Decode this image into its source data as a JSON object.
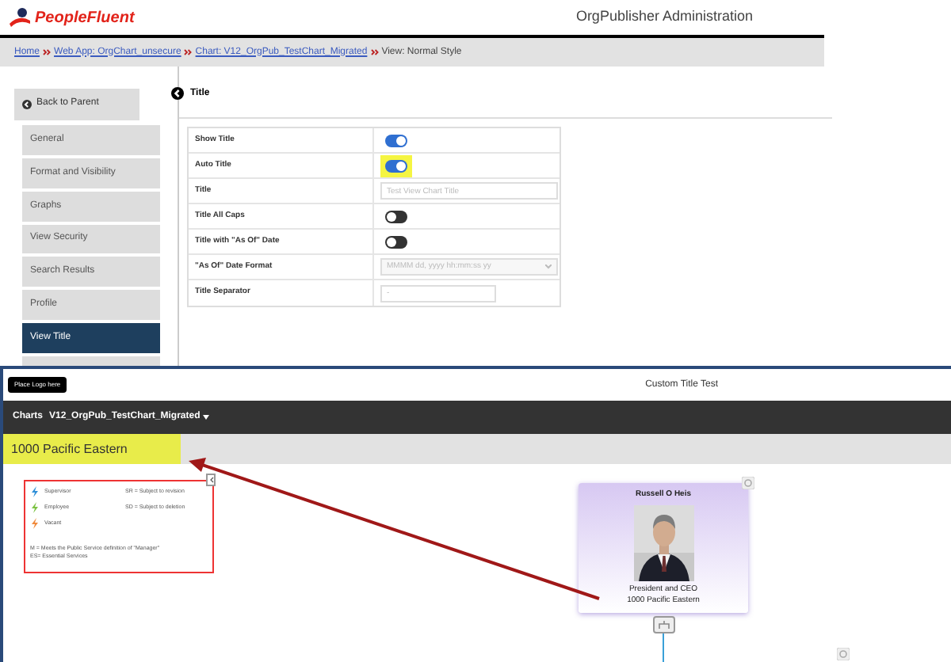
{
  "header": {
    "logo": "PeopleFluent",
    "title": "OrgPublisher Administration"
  },
  "breadcrumb": [
    {
      "kind": "link",
      "text": "Home"
    },
    {
      "kind": "link",
      "text": "Web App: OrgChart_unsecure"
    },
    {
      "kind": "link",
      "text": "Chart: V12_OrgPub_TestChart_Migrated"
    },
    {
      "kind": "text",
      "text": "View: Normal Style"
    }
  ],
  "sidebar": {
    "back": "Back to Parent",
    "items": [
      {
        "label": "General",
        "selected": false
      },
      {
        "label": "Format and Visibility",
        "selected": false
      },
      {
        "label": "Graphs",
        "selected": false
      },
      {
        "label": "View Security",
        "selected": false
      },
      {
        "label": "Search Results",
        "selected": false
      },
      {
        "label": "Profile",
        "selected": false
      },
      {
        "label": "View Title",
        "selected": true
      }
    ]
  },
  "section_title": "Title",
  "settings": [
    {
      "label": "Show Title",
      "kind": "toggle",
      "on": true,
      "highlighted": false
    },
    {
      "label": "Auto Title",
      "kind": "toggle",
      "on": true,
      "highlighted": true
    },
    {
      "label": "Title",
      "kind": "text",
      "placeholder": "Test View Chart Title"
    },
    {
      "label": "Title All Caps",
      "kind": "toggle",
      "on": false,
      "highlighted": false
    },
    {
      "label": "Title with \"As Of\" Date",
      "kind": "toggle",
      "on": false,
      "highlighted": false
    },
    {
      "label": "\"As Of\" Date Format",
      "kind": "select",
      "placeholder": "MMMM dd, yyyy hh:mm:ss yy"
    },
    {
      "label": "Title Separator",
      "kind": "short",
      "placeholder": "-"
    }
  ],
  "preview": {
    "logo": "Place Logo here",
    "title": "Custom Title Test",
    "nav_label": "Charts",
    "chart_name": "V12_OrgPub_TestChart_Migrated",
    "view_title": "1000 Pacific Eastern",
    "legend": {
      "items": [
        {
          "label": "Supervisor",
          "color": "#2f8fd8"
        },
        {
          "label": "Employee",
          "color": "#7cc242"
        },
        {
          "label": "Vacant",
          "color": "#f08a3c"
        }
      ],
      "codes": [
        "SR = Subject to revision",
        "SD = Subject to deletion"
      ],
      "notes": [
        "M = Meets the Public Service definition of \"Manager\"",
        "ES= Essential Services"
      ]
    },
    "card": {
      "name": "Russell O Heis",
      "position": "President and CEO",
      "unit": "1000 Pacific Eastern"
    }
  }
}
